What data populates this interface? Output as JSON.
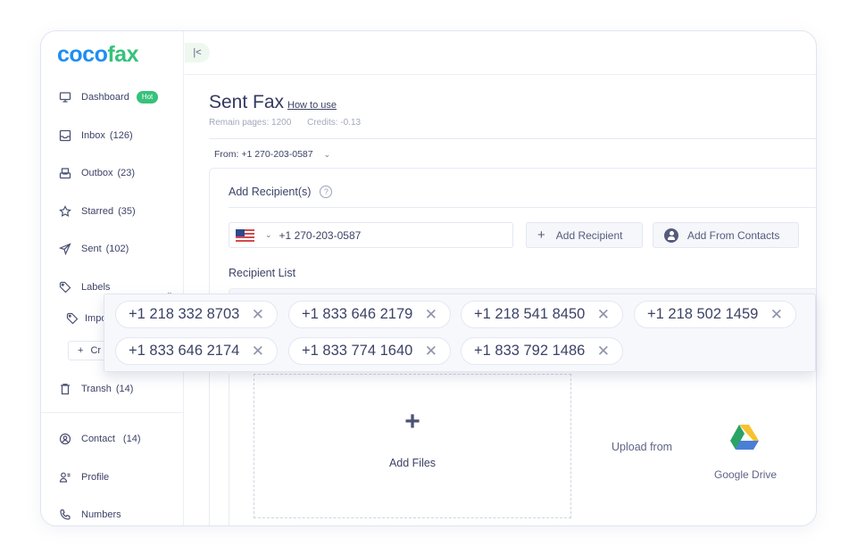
{
  "brand": {
    "part1": "coco",
    "part2": "fax",
    "color1": "#1d8ff2",
    "color2": "#35c27a"
  },
  "sidebar": {
    "items": [
      {
        "label": "Dashboard",
        "count": "",
        "icon": "monitor-icon",
        "badge": "Hot"
      },
      {
        "label": "Inbox",
        "count": "(126)",
        "icon": "inbox-icon"
      },
      {
        "label": "Outbox",
        "count": "(23)",
        "icon": "outbox-icon"
      },
      {
        "label": "Starred",
        "count": "(35)",
        "icon": "star-icon"
      },
      {
        "label": "Sent",
        "count": "(102)",
        "icon": "send-icon"
      },
      {
        "label": "Labels",
        "count": "",
        "icon": "tag-icon"
      },
      {
        "label": "Transh",
        "count": "(14)",
        "icon": "trash-icon"
      },
      {
        "label": "Contact",
        "count": "(14)",
        "icon": "contact-icon"
      },
      {
        "label": "Profile",
        "count": "",
        "icon": "profile-icon"
      },
      {
        "label": "Numbers",
        "count": "",
        "icon": "phone-icon"
      }
    ],
    "labels_sub": {
      "label": "Impo",
      "icon": "tag-icon"
    },
    "create_label": {
      "plus": "+",
      "label": "Cr"
    }
  },
  "topbar": {
    "collapse_icon": "|<"
  },
  "main": {
    "title": "Sent Fax",
    "how_to_use": "How to use",
    "remain_pages": "Remain pages: 1200",
    "credits": "Credits: -0.13",
    "from_label": "From: +1 270-203-0587",
    "chevron": "⌄"
  },
  "recipients": {
    "title": "Add Recipient(s)",
    "help": "?",
    "country": "US",
    "phone_value": "+1 270-203-0587",
    "add_button": "Add Recipient",
    "add_contacts_button": "Add From Contacts",
    "list_title": "Recipient List",
    "chips": [
      "+1 218 332 8703",
      "+1 833 646 2179",
      "+1 218 541 8450",
      "+1 218 502 1459",
      "+1 833 646 2174",
      "+1 833 774 1640",
      "+1 833 792 1486"
    ],
    "remove_glyph": "✕"
  },
  "upload": {
    "plus": "+",
    "add_files": "Add Files",
    "upload_from": "Upload from",
    "google_drive": "Google Drive"
  }
}
